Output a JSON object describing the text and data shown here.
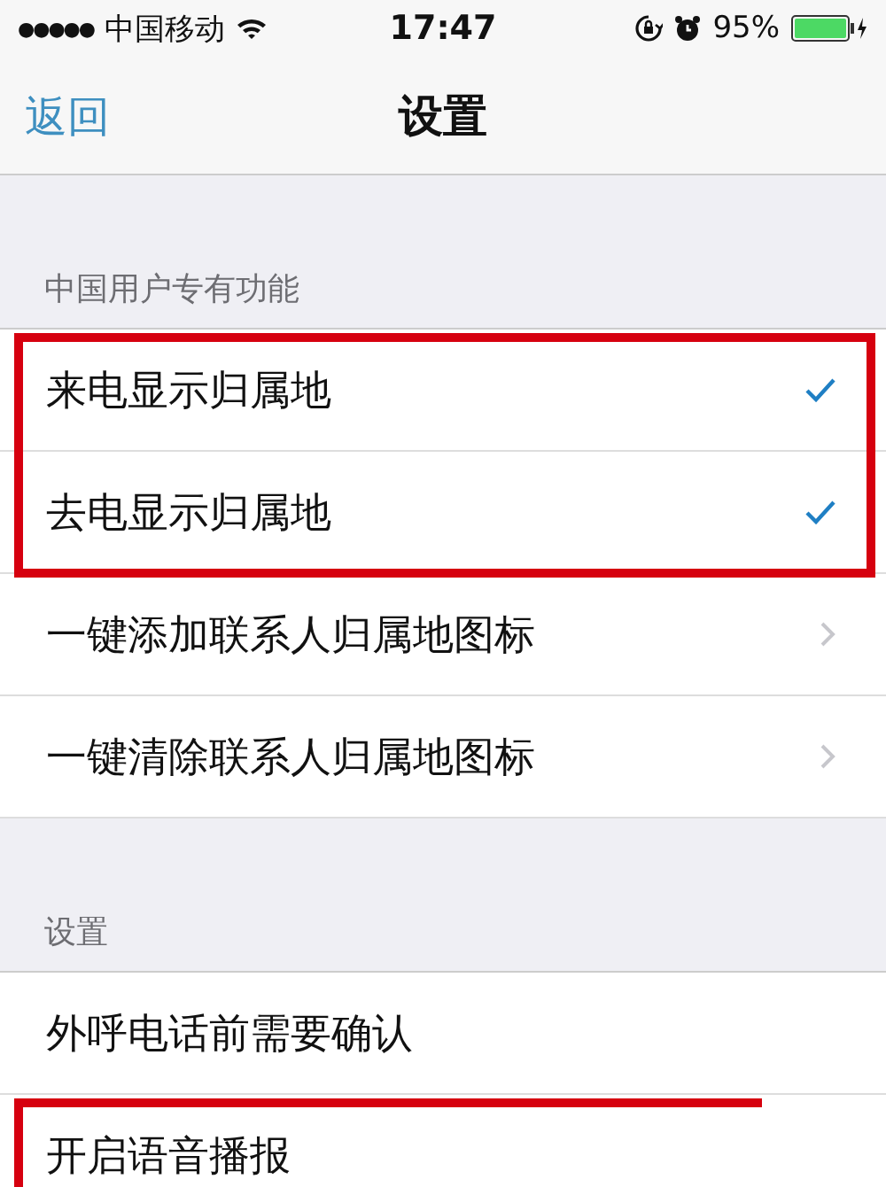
{
  "status_bar": {
    "signal_dots": "●●●●●",
    "carrier": "中国移动",
    "time": "17:47",
    "battery_percent": "95%"
  },
  "nav": {
    "back": "返回",
    "title": "设置"
  },
  "sections": [
    {
      "header": "中国用户专有功能",
      "rows": [
        {
          "kind": "check",
          "label": "来电显示归属地",
          "checked": true,
          "highlighted": true
        },
        {
          "kind": "check",
          "label": "去电显示归属地",
          "checked": true,
          "highlighted": true
        },
        {
          "kind": "disclosure",
          "label": "一键添加联系人归属地图标",
          "highlighted": false
        },
        {
          "kind": "disclosure",
          "label": "一键清除联系人归属地图标",
          "highlighted": false
        }
      ]
    },
    {
      "header": "设置",
      "rows": [
        {
          "kind": "plain",
          "label": "外呼电话前需要确认",
          "highlighted": false
        },
        {
          "kind": "plain",
          "label": "开启语音播报",
          "highlighted": true
        }
      ]
    }
  ]
}
